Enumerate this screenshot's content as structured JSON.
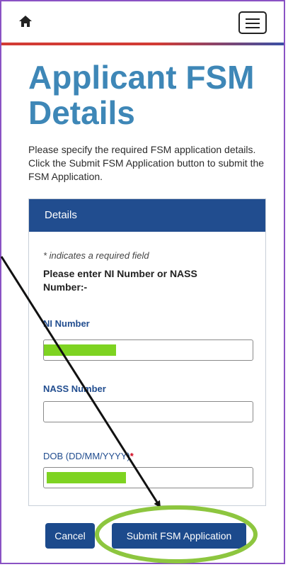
{
  "header": {
    "home_icon": "home-icon",
    "menu_icon": "hamburger-menu-icon"
  },
  "page": {
    "title": "Applicant FSM Details",
    "intro": "Please specify the required FSM application details. Click the Submit FSM Application button to submit the FSM Application."
  },
  "card": {
    "header": "Details",
    "required_note": "* indicates a required field",
    "instruction": "Please enter NI Number or NASS Number:-",
    "ni_label": "NI Number",
    "nass_label": "NASS Number",
    "dob_label": "DOB  (DD/MM/YYYY)",
    "dob_required": "*"
  },
  "actions": {
    "cancel_label": "Cancel",
    "submit_label": "Submit FSM Application"
  },
  "colors": {
    "title": "#3e87b7",
    "card_header": "#214d8f",
    "button": "#1c4a8c",
    "redaction": "#7ed321",
    "annotation_highlight": "#8dc63f",
    "frame_border": "#8a52c4"
  }
}
